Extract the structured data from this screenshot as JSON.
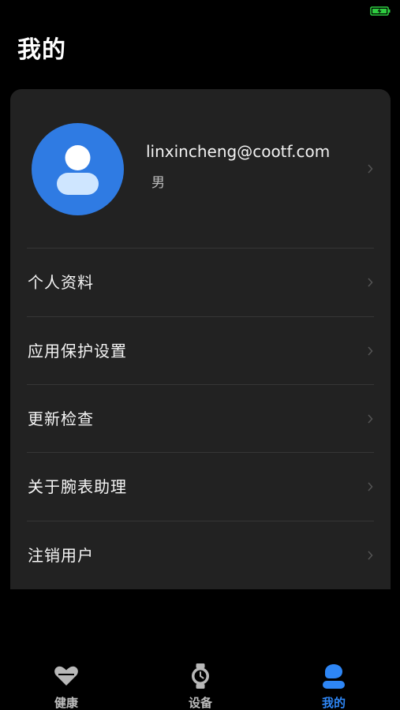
{
  "page": {
    "title": "我的"
  },
  "profile": {
    "email": "linxincheng@cootf.com",
    "gender": "男"
  },
  "menu": [
    {
      "label": "个人资料"
    },
    {
      "label": "应用保护设置"
    },
    {
      "label": "更新检查"
    },
    {
      "label": "关于腕表助理"
    },
    {
      "label": "注销用户"
    }
  ],
  "tabs": [
    {
      "label": "健康",
      "icon": "heart-icon",
      "active": false
    },
    {
      "label": "设备",
      "icon": "watch-icon",
      "active": false
    },
    {
      "label": "我的",
      "icon": "person-icon",
      "active": true
    }
  ],
  "colors": {
    "background": "#000000",
    "card": "#222222",
    "accent": "#2e86f5",
    "avatar": "#2f7be3",
    "battery": "#2ecc40"
  }
}
